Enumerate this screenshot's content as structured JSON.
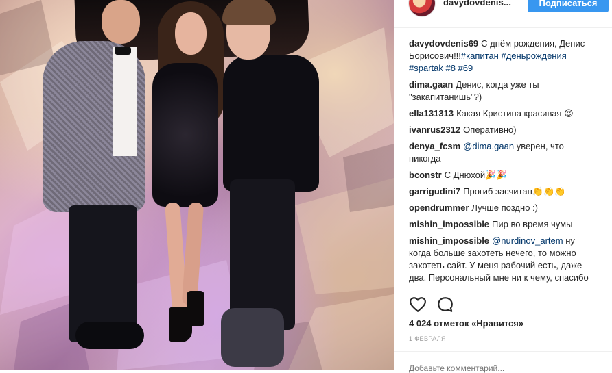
{
  "header": {
    "username": "davydovdenis...",
    "follow_label": "Подписаться"
  },
  "caption": {
    "username": "davydovdenis69",
    "text": "С днём рождения, Денис Борисович!!!",
    "tags": "#капитан #деньрождения #spartak #8 #69"
  },
  "comments": [
    {
      "user": "dima.gaan",
      "text": "Денис, когда уже ты \"закапитанишь\"?)"
    },
    {
      "user": "ella131313",
      "text": "Какая Кристина красивая 😍"
    },
    {
      "user": "ivanrus2312",
      "text": "Оперативно)"
    },
    {
      "user": "denya_fcsm",
      "mention": "@dima.gaan",
      "text": "уверен, что никогда"
    },
    {
      "user": "bconstr",
      "text": "С Днюхой🎉🎉"
    },
    {
      "user": "garrigudini7",
      "text": "Прогиб засчитан👏👏👏"
    },
    {
      "user": "opendrummer",
      "text": "Лучше поздно :)"
    },
    {
      "user": "mishin_impossible",
      "text": "Пир во время чумы"
    },
    {
      "user": "mishin_impossible",
      "mention": "@nurdinov_artem",
      "text": "ну когда больше захотеть нечего, то можно захотеть сайт. У меня рабочий есть, даже два. Персональный мне ни к чему, спасибо"
    }
  ],
  "likes_text": "4 024 отметок «Нравится»",
  "date_text": "1 ФЕВРАЛЯ",
  "add_comment_placeholder": "Добавьте комментарий...",
  "icons": {
    "like": "heart-icon",
    "comment": "speech-bubble-icon"
  },
  "colors": {
    "follow_button": "#3897f0",
    "link": "#003569",
    "muted": "#999999"
  }
}
